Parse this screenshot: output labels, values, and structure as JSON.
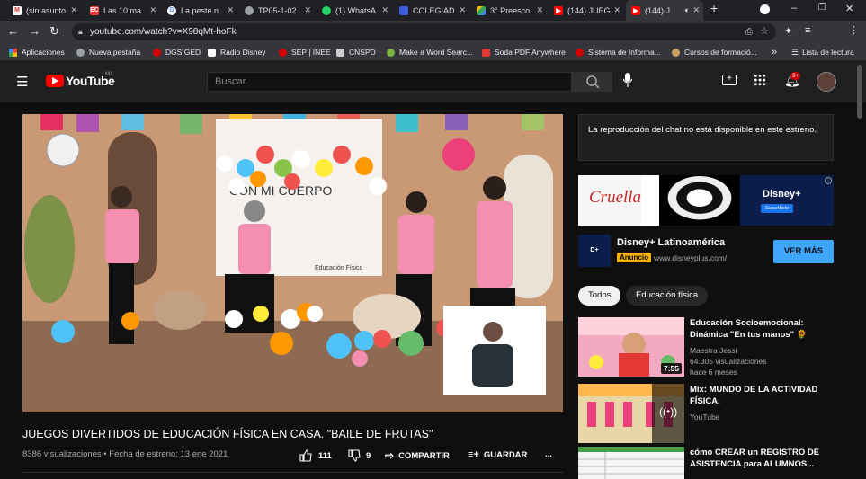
{
  "browser": {
    "tabs": [
      {
        "label": "(sin asunto",
        "icon": "gmail-icon",
        "color": "#d93025"
      },
      {
        "label": "Las 10 ma",
        "icon": "ec-icon",
        "color": "#e53935"
      },
      {
        "label": "La peste n",
        "icon": "google-icon",
        "color": "#4285f4"
      },
      {
        "label": "TP05-1-02",
        "icon": "globe-icon",
        "color": "#9aa0a6"
      },
      {
        "label": "(1) WhatsA",
        "icon": "whatsapp-icon",
        "color": "#25d366"
      },
      {
        "label": "COLEGIAD",
        "icon": "doc-icon",
        "color": "#3b5bdb"
      },
      {
        "label": "3° Preesco",
        "icon": "drive-icon",
        "color": "#fbbc04"
      },
      {
        "label": "(144) JUEG",
        "icon": "youtube-icon",
        "color": "#ff0000"
      },
      {
        "label": "(144) J",
        "icon": "youtube-icon",
        "color": "#ff0000"
      }
    ],
    "url": "youtube.com/watch?v=X98qMt-hoFk",
    "bookmarks": [
      {
        "label": "Aplicaciones",
        "color": "#ea4335"
      },
      {
        "label": "Nueva pestaña",
        "color": "#9aa0a6"
      },
      {
        "label": "DGSIGED",
        "color": "#d50000"
      },
      {
        "label": "Radio Disney",
        "color": "#ffffff"
      },
      {
        "label": "SEP | INEE",
        "color": "#d50000"
      },
      {
        "label": "CNSPD",
        "color": "#cccccc"
      },
      {
        "label": "Make a Word Searc...",
        "color": "#7cb342"
      },
      {
        "label": "Soda PDF Anywhere",
        "color": "#e53935"
      },
      {
        "label": "Sistema de Informa...",
        "color": "#d50000"
      },
      {
        "label": "Cursos de formació...",
        "color": "#c8a165"
      }
    ],
    "more_bookmarks": "»",
    "reading_list": "Lista de lectura"
  },
  "youtube": {
    "logo": "YouTube",
    "region": "MX",
    "search_placeholder": "Buscar",
    "notifications": "9+"
  },
  "video": {
    "title": "JUEGOS DIVERTIDOS DE EDUCACIÓN FÍSICA EN CASA. \"BAILE DE FRUTAS\"",
    "meta": "8386 visualizaciones • Fecha de estreno: 13 ene 2021",
    "likes": "111",
    "dislikes": "9",
    "share": "COMPARTIR",
    "save": "GUARDAR",
    "more": "...",
    "banner_text": "CON MI CUERPO",
    "banner_sub": "Educación Física"
  },
  "sidebar": {
    "chat_text": "La reproducción del chat no está disponible en este estreno.",
    "ad": {
      "brand": "Disney+ Latinoamérica",
      "badge": "Anuncio",
      "domain": "www.disneyplus.com/",
      "cta": "VER MÁS",
      "banner_title": "Cruella",
      "banner_logo": "Disney+",
      "banner_cta": "Suscríbete"
    },
    "chips": [
      "Todos",
      "Educación física"
    ],
    "recommendations": [
      {
        "title": "Educación Socioemocional: Dinámica \"En tus manos\" 🌻",
        "channel": "Maestra Jessi",
        "views": "64.305 visualizaciones",
        "age": "hace 6 meses",
        "duration": "7:55"
      },
      {
        "title": "Mix: MUNDO DE LA ACTIVIDAD FÍSICA.",
        "channel": "YouTube",
        "views": "",
        "age": "",
        "duration": ""
      },
      {
        "title": "cómo CREAR un REGISTRO DE ASISTENCIA para ALUMNOS...",
        "channel": "",
        "views": "",
        "age": "",
        "duration": ""
      }
    ]
  }
}
